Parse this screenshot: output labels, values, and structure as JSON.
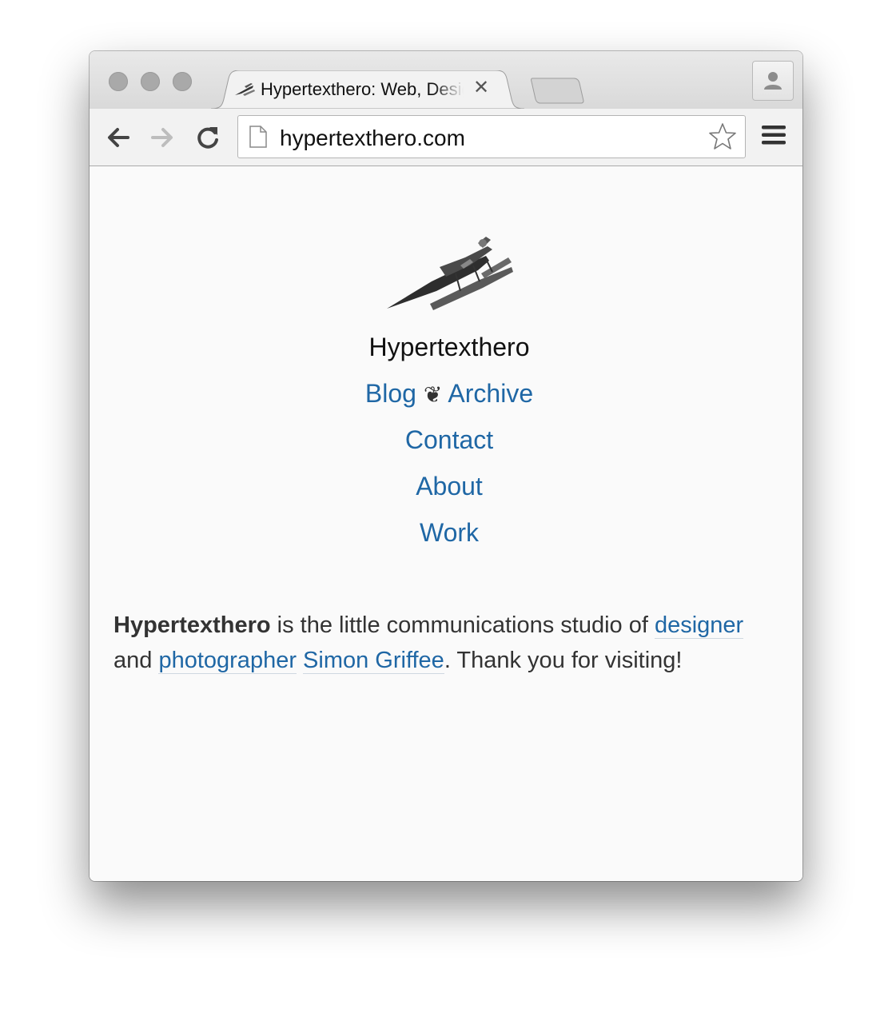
{
  "browser": {
    "tab": {
      "title": "Hypertexthero: Web, Design",
      "close_glyph": "✕",
      "favicon": "seaplane-icon"
    },
    "url": "hypertexthero.com",
    "icons": {
      "back": "back-arrow-icon",
      "forward": "forward-arrow-icon",
      "reload": "reload-icon",
      "page": "page-icon",
      "bookmark": "star-icon",
      "menu": "hamburger-menu-icon",
      "profile": "person-icon"
    }
  },
  "page": {
    "site_title": "Hypertexthero",
    "nav": {
      "blog": "Blog",
      "separator": "❦",
      "archive": "Archive",
      "contact": "Contact",
      "about": "About",
      "work": "Work"
    },
    "intro": {
      "brand": "Hypertexthero",
      "text1": " is the little communications studio of ",
      "link_designer": "designer",
      "text2": " and ",
      "link_photographer": "photographer",
      "text3": " ",
      "link_name": "Simon Griffee",
      "text4": ". Thank you for visiting!"
    }
  },
  "colors": {
    "link": "#1f67a5",
    "text": "#333333",
    "page_bg": "#fafafa"
  }
}
